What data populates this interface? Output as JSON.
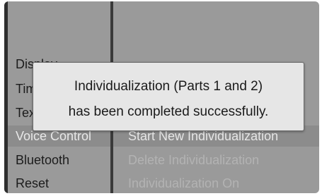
{
  "menu": {
    "items": [
      {
        "label": "Display"
      },
      {
        "label": "Time"
      },
      {
        "label": "Text"
      },
      {
        "label": "Voice Control"
      },
      {
        "label": "Bluetooth"
      },
      {
        "label": "Reset"
      }
    ],
    "selected_index": 3
  },
  "submenu": {
    "items": [
      {
        "label": "Start New Individualization",
        "state": "enabled"
      },
      {
        "label": "Delete Individualization",
        "state": "disabled"
      },
      {
        "label": "Individualization On",
        "state": "disabled"
      }
    ]
  },
  "dialog": {
    "line1": "Individualization (Parts 1 and 2)",
    "line2": "has been completed successfully."
  }
}
